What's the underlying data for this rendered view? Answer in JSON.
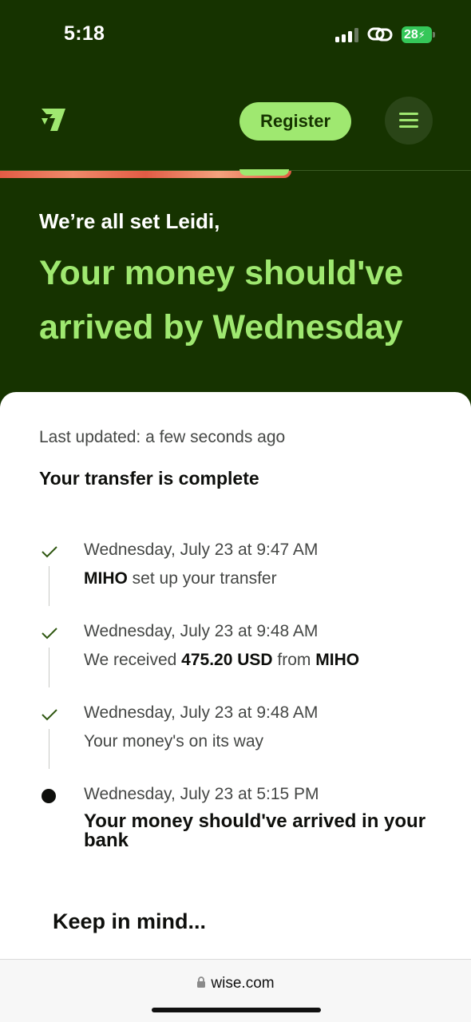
{
  "status_bar": {
    "time": "5:18",
    "battery": "28"
  },
  "header": {
    "logo_icon": "wise-flag-logo",
    "register_label": "Register",
    "menu_icon": "hamburger-menu-icon"
  },
  "hero": {
    "greeting": "We’re all set Leidi,",
    "title": "Your money should've arrived by Wednesday"
  },
  "card": {
    "last_updated": "Last updated: a few seconds ago",
    "status_title": "Your transfer is complete",
    "steps": [
      {
        "time": "Wednesday, July 23 at 9:47 AM",
        "desc_bold_1": "MIHO",
        "desc_text_1": " set up your transfer",
        "state": "done"
      },
      {
        "time": "Wednesday, July 23 at 9:48 AM",
        "desc_text_1": "We received ",
        "desc_bold_1": "475.20 USD",
        "desc_text_2": " from ",
        "desc_bold_2": "MIHO",
        "state": "done"
      },
      {
        "time": "Wednesday, July 23 at 9:48 AM",
        "desc_text_1": "Your money's on its way",
        "state": "done"
      },
      {
        "time": "Wednesday, July 23 at 5:15 PM",
        "desc_final": "Your money should've arrived in your bank",
        "state": "current"
      }
    ],
    "keep_in_mind": "Keep in mind..."
  },
  "browser": {
    "url": "wise.com"
  },
  "colors": {
    "brand_dark": "#163300",
    "brand_green": "#9fe870",
    "battery_green": "#35c759"
  }
}
